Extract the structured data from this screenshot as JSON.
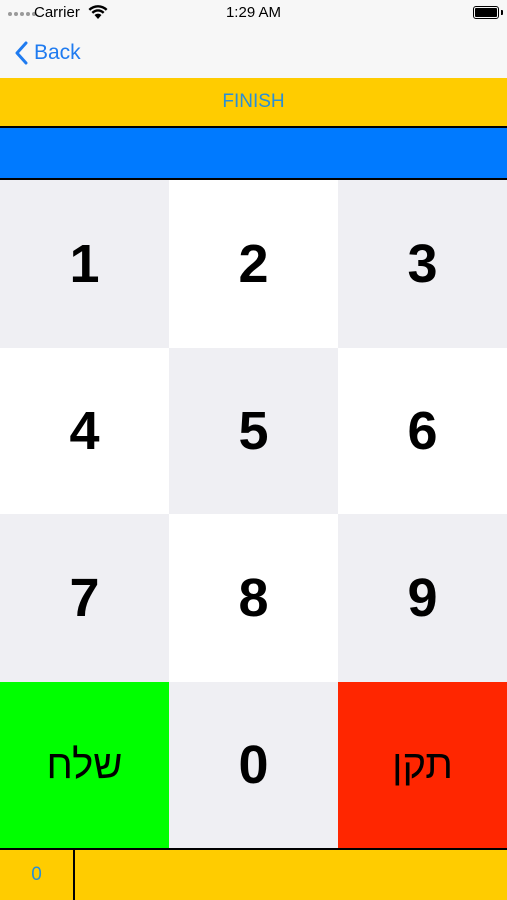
{
  "status_bar": {
    "carrier": "Carrier",
    "time": "1:29 AM",
    "wifi_icon": "wifi-icon",
    "battery_icon": "battery-icon"
  },
  "nav": {
    "back_label": "Back",
    "back_icon": "chevron-left-icon"
  },
  "finish_label": "FINISH",
  "display_value": "",
  "keypad": {
    "k1": "1",
    "k2": "2",
    "k3": "3",
    "k4": "4",
    "k5": "5",
    "k6": "6",
    "k7": "7",
    "k8": "8",
    "k9": "9",
    "send": "שלח",
    "k0": "0",
    "fix": "תקן"
  },
  "colors": {
    "accent_blue": "#007aff",
    "finish_yellow": "#ffcc00",
    "send_green": "#00ff00",
    "fix_red": "#ff2600",
    "link_blue": "#1f7bf0"
  },
  "bottom_bar": {
    "count": "0"
  }
}
